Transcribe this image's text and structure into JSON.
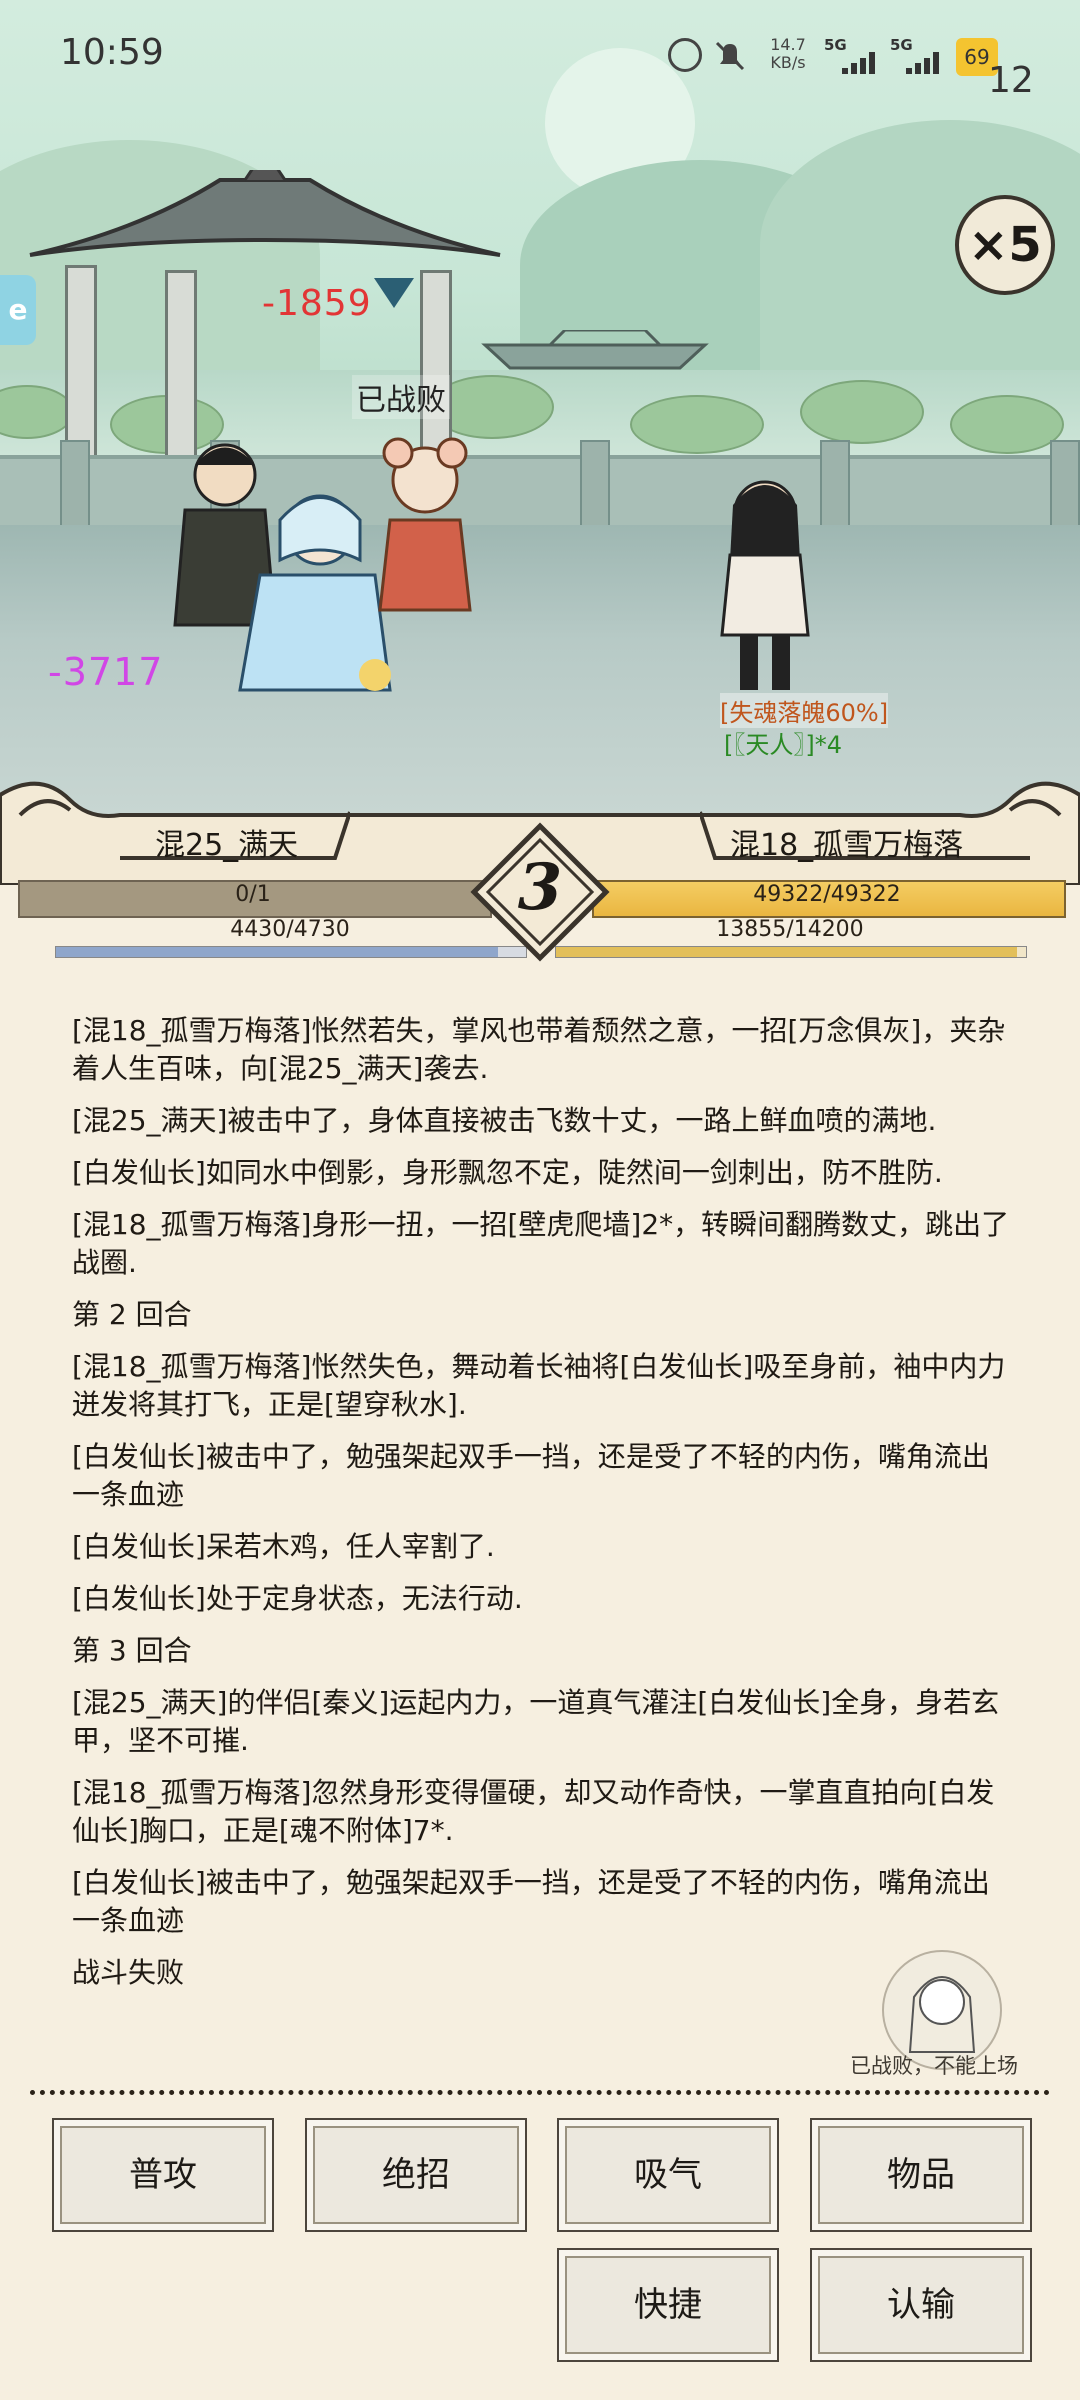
{
  "status_bar": {
    "time": "10:59",
    "net_speed_value": "14.7",
    "net_speed_unit": "KB/s",
    "signal_1": "5G",
    "signal_2": "5G",
    "battery": "69",
    "corner_number": "12",
    "icons": [
      "alarm-icon",
      "mute-bell-icon",
      "signal-icon",
      "signal-icon",
      "battery-icon"
    ]
  },
  "battle": {
    "speed": "×5",
    "left_tab_label": "e",
    "damage_top": "-1859",
    "damage_left": "-3717",
    "defeated_label": "已战败",
    "enemy_status": "[失魂落魄60%]",
    "enemy_title": "[〖天人〗]*4",
    "left_team_name": "混25_满天",
    "right_team_name": "混18_孤雪万梅落",
    "round": "3",
    "left_hp": "0/1",
    "left_mp": "4430/4730",
    "left_mp_fraction": 0.937,
    "right_hp": "49322/49322",
    "right_mp": "13855/14200",
    "right_mp_fraction": 0.976
  },
  "log": [
    "[混18_孤雪万梅落]怅然若失，掌风也带着颓然之意，一招[万念俱灰]，夹杂着人生百味，向[混25_满天]袭去.",
    "[混25_满天]被击中了，身体直接被击飞数十丈，一路上鲜血喷的满地.",
    "[白发仙长]如同水中倒影，身形飘忽不定，陡然间一剑刺出，防不胜防.",
    "[混18_孤雪万梅落]身形一扭，一招[壁虎爬墙]2*，转瞬间翻腾数丈，跳出了战圈.",
    "第 2 回合",
    "[混18_孤雪万梅落]怅然失色，舞动着长袖将[白发仙长]吸至身前，袖中内力迸发将其打飞，正是[望穿秋水].",
    "[白发仙长]被击中了，勉强架起双手一挡，还是受了不轻的内伤，嘴角流出一条血迹",
    "[白发仙长]呆若木鸡，任人宰割了.",
    "[白发仙长]处于定身状态，无法行动.",
    "第 3 回合",
    "[混25_满天]的伴侣[秦义]运起内力，一道真气灌注[白发仙长]全身，身若玄甲，坚不可摧.",
    "[混18_孤雪万梅落]忽然身形变得僵硬，却又动作奇快，一掌直直拍向[白发仙长]胸口，正是[魂不附体]7*.",
    "[白发仙长]被击中了，勉强架起双手一挡，还是受了不轻的内伤，嘴角流出一条血迹",
    "战斗失败"
  ],
  "portrait_note": "已战败，不能上场",
  "buttons": {
    "attack": "普攻",
    "ultimate": "绝招",
    "breathe": "吸气",
    "items": "物品",
    "quick": "快捷",
    "surrender": "认输"
  }
}
